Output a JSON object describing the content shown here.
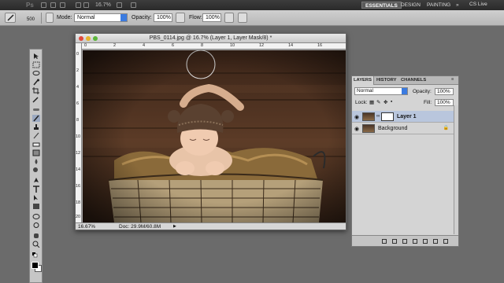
{
  "appbar": {
    "logo": "Ps",
    "zoom": "16.7%",
    "workspaces": [
      "ESSENTIALS",
      "DESIGN",
      "PAINTING"
    ],
    "more": "»",
    "cslive": "CS Live"
  },
  "options": {
    "brush_size": "500",
    "mode_label": "Mode:",
    "mode_value": "Normal",
    "opacity_label": "Opacity:",
    "opacity_value": "100%",
    "flow_label": "Flow:",
    "flow_value": "100%"
  },
  "document": {
    "title": "PBS_0114.jpg @ 16.7% (Layer 1, Layer Mask/8) *",
    "ruler_h": [
      "0",
      "2",
      "4",
      "6",
      "8",
      "10",
      "12",
      "14",
      "16"
    ],
    "ruler_v": [
      "0",
      "2",
      "4",
      "6",
      "8",
      "10",
      "12",
      "14",
      "16",
      "18",
      "20"
    ],
    "zoom_status": "16.67%",
    "doc_status": "Doc: 29.9M/60.8M"
  },
  "layers_panel": {
    "tabs": [
      "LAYERS",
      "HISTORY",
      "CHANNELS"
    ],
    "blend_mode": "Normal",
    "opacity_label": "Opacity:",
    "opacity_value": "100%",
    "lock_label": "Lock:",
    "fill_label": "Fill:",
    "fill_value": "100%",
    "layers": [
      {
        "name": "Layer 1",
        "selected": true,
        "has_mask": true
      },
      {
        "name": "Background",
        "selected": false,
        "has_mask": false,
        "locked": true
      }
    ]
  },
  "colors": {
    "foreground": "#000000",
    "background": "#ffffff",
    "accent": "#3b7be0"
  }
}
